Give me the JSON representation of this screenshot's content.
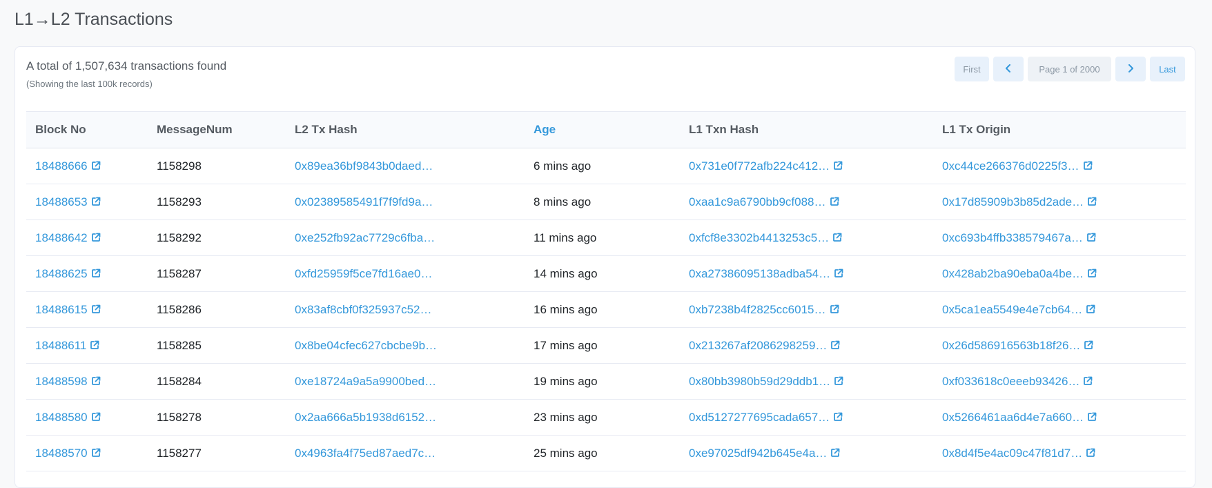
{
  "page": {
    "title": "L1→L2 Transactions"
  },
  "summary": {
    "total": "A total of 1,507,634 transactions found",
    "sub": "(Showing the last 100k records)"
  },
  "pagination": {
    "first": "First",
    "prev_icon": "chevron-left-icon",
    "info": "Page 1 of 2000",
    "next_icon": "chevron-right-icon",
    "last": "Last"
  },
  "colors": {
    "link": "#3498db",
    "header_bg": "#f8fafd",
    "pager_bg": "#e8f1fb"
  },
  "table": {
    "headers": [
      "Block No",
      "MessageNum",
      "L2 Tx Hash",
      "Age",
      "L1 Txn Hash",
      "L1 Tx Origin"
    ],
    "sorted_column": "Age",
    "rows": [
      {
        "block": "18488666",
        "msg": "1158298",
        "l2hash": "0x89ea36bf9843b0daed…",
        "age": "6 mins ago",
        "l1hash": "0x731e0f772afb224c412…",
        "origin": "0xc44ce266376d0225f3…"
      },
      {
        "block": "18488653",
        "msg": "1158293",
        "l2hash": "0x02389585491f7f9fd9a…",
        "age": "8 mins ago",
        "l1hash": "0xaa1c9a6790bb9cf088…",
        "origin": "0x17d85909b3b85d2ade…"
      },
      {
        "block": "18488642",
        "msg": "1158292",
        "l2hash": "0xe252fb92ac7729c6fba…",
        "age": "11 mins ago",
        "l1hash": "0xfcf8e3302b4413253c5…",
        "origin": "0xc693b4ffb338579467a…"
      },
      {
        "block": "18488625",
        "msg": "1158287",
        "l2hash": "0xfd25959f5ce7fd16ae0…",
        "age": "14 mins ago",
        "l1hash": "0xa27386095138adba54…",
        "origin": "0x428ab2ba90eba0a4be…"
      },
      {
        "block": "18488615",
        "msg": "1158286",
        "l2hash": "0x83af8cbf0f325937c52…",
        "age": "16 mins ago",
        "l1hash": "0xb7238b4f2825cc6015…",
        "origin": "0x5ca1ea5549e4e7cb64…"
      },
      {
        "block": "18488611",
        "msg": "1158285",
        "l2hash": "0x8be04cfec627cbcbe9b…",
        "age": "17 mins ago",
        "l1hash": "0x213267af2086298259…",
        "origin": "0x26d586916563b18f26…"
      },
      {
        "block": "18488598",
        "msg": "1158284",
        "l2hash": "0xe18724a9a5a9900bed…",
        "age": "19 mins ago",
        "l1hash": "0x80bb3980b59d29ddb1…",
        "origin": "0xf033618c0eeeb93426…"
      },
      {
        "block": "18488580",
        "msg": "1158278",
        "l2hash": "0x2aa666a5b1938d6152…",
        "age": "23 mins ago",
        "l1hash": "0xd5127277695cada657…",
        "origin": "0x5266461aa6d4e7a660…"
      },
      {
        "block": "18488570",
        "msg": "1158277",
        "l2hash": "0x4963fa4f75ed87aed7c…",
        "age": "25 mins ago",
        "l1hash": "0xe97025df942b645e4a…",
        "origin": "0x8d4f5e4ac09c47f81d7…"
      }
    ]
  }
}
